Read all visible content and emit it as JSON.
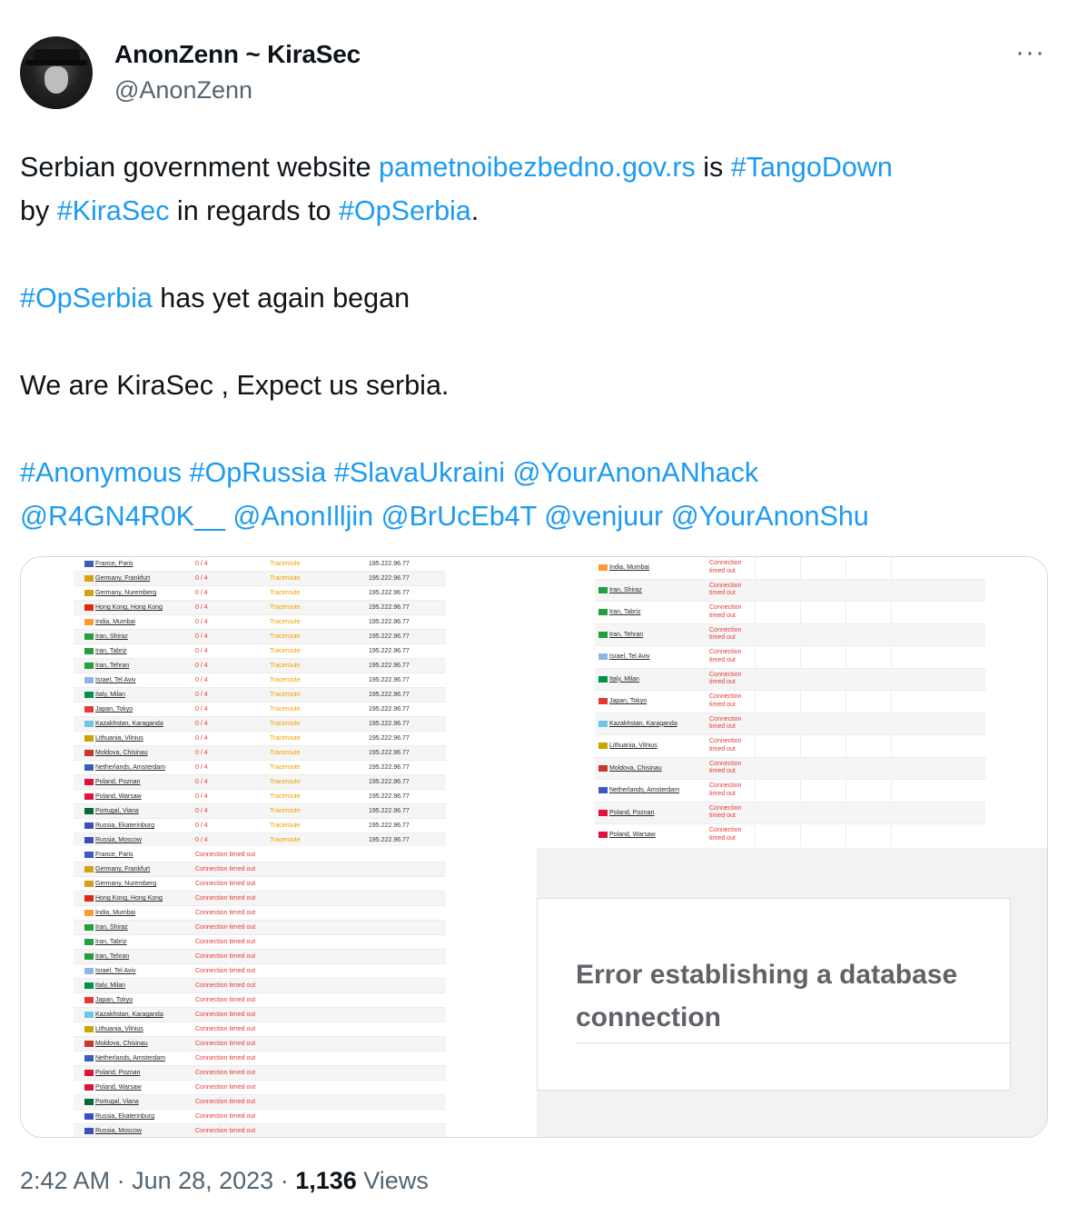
{
  "author": {
    "display_name": "AnonZenn ~ KiraSec",
    "handle": "@AnonZenn"
  },
  "menu_icon": "more-horizontal-icon",
  "tweet": {
    "line1": {
      "t1": "Serbian government website ",
      "link": "pametnoibezbedno.gov.rs",
      "t2": " is ",
      "tag": "#TangoDown"
    },
    "line2": {
      "t1": "by ",
      "tag1": "#KiraSec",
      "t2": " in regards to ",
      "tag2": "#OpSerbia",
      "t3": "."
    },
    "line3": {
      "tag": "#OpSerbia",
      "t1": " has yet again began"
    },
    "line4": "We are KiraSec , Expect us serbia.",
    "line5": [
      "#Anonymous",
      "#OpRussia",
      "#SlavaUkraini",
      "@YourAnonANhack"
    ],
    "line6": [
      "@R4GN4R0K__",
      "@AnonIlljin",
      "@BrUcEb4T",
      "@venjuur",
      "@YourAnonShu"
    ]
  },
  "media": {
    "traceroute_table": {
      "result": "0 / 4",
      "action": "Traceroute",
      "ip": "195.222.96.77",
      "locations": [
        "France, Paris",
        "Germany, Frankfurt",
        "Germany, Nuremberg",
        "Hong Kong, Hong Kong",
        "India, Mumbai",
        "Iran, Shiraz",
        "Iran, Tabriz",
        "Iran, Tehran",
        "Israel, Tel Aviv",
        "Italy, Milan",
        "Japan, Tokyo",
        "Kazakhstan, Karaganda",
        "Lithuania, Vilnius",
        "Moldova, Chisinau",
        "Netherlands, Amsterdam",
        "Poland, Poznan",
        "Poland, Warsaw",
        "Portugal, Viana",
        "Russia, Ekaterinburg",
        "Russia, Moscow",
        "Russia, Moscow"
      ]
    },
    "timeout_table_right": {
      "error": "Connection timed out",
      "locations": [
        "India, Mumbai",
        "Iran, Shiraz",
        "Iran, Tabriz",
        "Iran, Tehran",
        "Israel, Tel Aviv",
        "Italy, Milan",
        "Japan, Tokyo",
        "Kazakhstan, Karaganda",
        "Lithuania, Vilnius",
        "Moldova, Chisinau",
        "Netherlands, Amsterdam",
        "Poland, Poznan",
        "Poland, Warsaw"
      ]
    },
    "timeout_table_left": {
      "error": "Connection timed out",
      "locations": [
        "France, Paris",
        "Germany, Frankfurt",
        "Germany, Nuremberg",
        "Hong Kong, Hong Kong",
        "India, Mumbai",
        "Iran, Shiraz",
        "Iran, Tabriz",
        "Iran, Tehran",
        "Israel, Tel Aviv",
        "Italy, Milan",
        "Japan, Tokyo",
        "Kazakhstan, Karaganda",
        "Lithuania, Vilnius",
        "Moldova, Chisinau",
        "Netherlands, Amsterdam",
        "Poland, Poznan",
        "Poland, Warsaw",
        "Portugal, Viana",
        "Russia, Ekaterinburg",
        "Russia, Moscow",
        "Russia, Moscow"
      ]
    },
    "error_page": {
      "message": "Error establishing a database connection"
    }
  },
  "footer": {
    "time": "2:42 AM",
    "sep1": " · ",
    "date": "Jun 28, 2023",
    "sep2": " · ",
    "views_count": "1,136",
    "views_label": " Views"
  },
  "flag_colors": {
    "France": "#3b5bbf",
    "Germany": "#d4a017",
    "Hong Kong": "#de2910",
    "India": "#ff9933",
    "Iran": "#239f40",
    "Israel": "#8fb4e8",
    "Italy": "#009246",
    "Japan": "#e53935",
    "Kazakhstan": "#6ec6e6",
    "Lithuania": "#c8a400",
    "Moldova": "#c9372c",
    "Netherlands": "#3b5bbf",
    "Poland": "#dc143c",
    "Portugal": "#046a38",
    "Russia": "#3a4fbf"
  }
}
